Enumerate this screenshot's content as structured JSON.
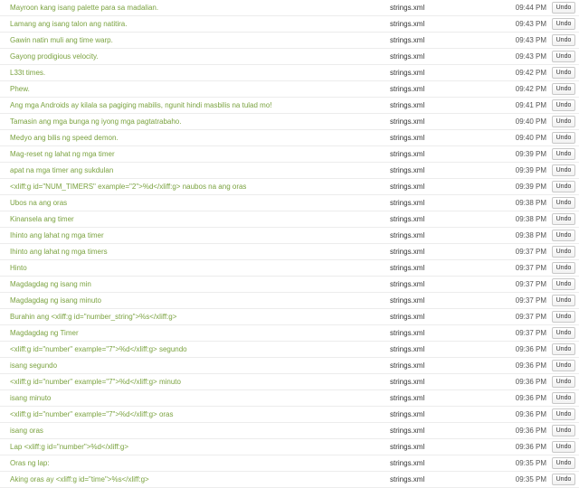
{
  "rows": [
    {
      "text": "Mayroon kang isang palette para sa madalian.",
      "file": "strings.xml",
      "time": "09:44 PM",
      "action": "Undo"
    },
    {
      "text": "Lamang ang isang talon ang natitira.",
      "file": "strings.xml",
      "time": "09:43 PM",
      "action": "Undo"
    },
    {
      "text": "Gawin natin muli ang time warp.",
      "file": "strings.xml",
      "time": "09:43 PM",
      "action": "Undo"
    },
    {
      "text": "Gayong prodigious velocity.",
      "file": "strings.xml",
      "time": "09:43 PM",
      "action": "Undo"
    },
    {
      "text": "L33t times.",
      "file": "strings.xml",
      "time": "09:42 PM",
      "action": "Undo"
    },
    {
      "text": "Phew.",
      "file": "strings.xml",
      "time": "09:42 PM",
      "action": "Undo"
    },
    {
      "text": "Ang mga Androids ay kilala sa pagiging mabilis, ngunit hindi masbilis na tulad mo!",
      "file": "strings.xml",
      "time": "09:41 PM",
      "action": "Undo"
    },
    {
      "text": "Tamasin ang mga bunga ng iyong mga pagtatrabaho.",
      "file": "strings.xml",
      "time": "09:40 PM",
      "action": "Undo"
    },
    {
      "text": "Medyo ang bilis ng speed demon.",
      "file": "strings.xml",
      "time": "09:40 PM",
      "action": "Undo"
    },
    {
      "text": "Mag-reset ng lahat ng mga timer",
      "file": "strings.xml",
      "time": "09:39 PM",
      "action": "Undo"
    },
    {
      "text": "apat na mga timer ang sukdulan",
      "file": "strings.xml",
      "time": "09:39 PM",
      "action": "Undo"
    },
    {
      "text": "<xliff:g id=\"NUM_TIMERS\" example=\"2\">%d</xliff:g> naubos na ang oras",
      "file": "strings.xml",
      "time": "09:39 PM",
      "action": "Undo"
    },
    {
      "text": "Ubos na ang oras",
      "file": "strings.xml",
      "time": "09:38 PM",
      "action": "Undo"
    },
    {
      "text": "Kinansela ang timer",
      "file": "strings.xml",
      "time": "09:38 PM",
      "action": "Undo"
    },
    {
      "text": "Ihinto ang lahat ng mga timer",
      "file": "strings.xml",
      "time": "09:38 PM",
      "action": "Undo"
    },
    {
      "text": "Ihinto ang lahat ng mga timers",
      "file": "strings.xml",
      "time": "09:37 PM",
      "action": "Undo"
    },
    {
      "text": "Hinto",
      "file": "strings.xml",
      "time": "09:37 PM",
      "action": "Undo"
    },
    {
      "text": "Magdagdag ng isang min",
      "file": "strings.xml",
      "time": "09:37 PM",
      "action": "Undo"
    },
    {
      "text": "Magdagdag ng isang minuto",
      "file": "strings.xml",
      "time": "09:37 PM",
      "action": "Undo"
    },
    {
      "text": "Burahin ang <xliff:g id=\"number_string\">%s</xliff:g>",
      "file": "strings.xml",
      "time": "09:37 PM",
      "action": "Undo"
    },
    {
      "text": "Magdagdag ng Timer",
      "file": "strings.xml",
      "time": "09:37 PM",
      "action": "Undo"
    },
    {
      "text": "<xliff:g id=\"number\" example=\"7\">%d</xliff:g> segundo",
      "file": "strings.xml",
      "time": "09:36 PM",
      "action": "Undo"
    },
    {
      "text": "isang segundo",
      "file": "strings.xml",
      "time": "09:36 PM",
      "action": "Undo"
    },
    {
      "text": "<xliff:g id=\"number\" example=\"7\">%d</xliff:g> minuto",
      "file": "strings.xml",
      "time": "09:36 PM",
      "action": "Undo"
    },
    {
      "text": "isang minuto",
      "file": "strings.xml",
      "time": "09:36 PM",
      "action": "Undo"
    },
    {
      "text": "<xliff:g id=\"number\" example=\"7\">%d</xliff:g> oras",
      "file": "strings.xml",
      "time": "09:36 PM",
      "action": "Undo"
    },
    {
      "text": "isang oras",
      "file": "strings.xml",
      "time": "09:36 PM",
      "action": "Undo"
    },
    {
      "text": "Lap <xliff:g id=\"number\">%d</xliff:g>",
      "file": "strings.xml",
      "time": "09:36 PM",
      "action": "Undo"
    },
    {
      "text": "Oras ng lap:",
      "file": "strings.xml",
      "time": "09:35 PM",
      "action": "Undo"
    },
    {
      "text": "Aking oras ay <xliff:g id=\"time\">%s</xliff:g>",
      "file": "strings.xml",
      "time": "09:35 PM",
      "action": "Undo"
    }
  ],
  "colors": {
    "translation_text": "#7aa23f",
    "file_text": "#333333",
    "time_text": "#555555",
    "row_border": "#ececec"
  }
}
